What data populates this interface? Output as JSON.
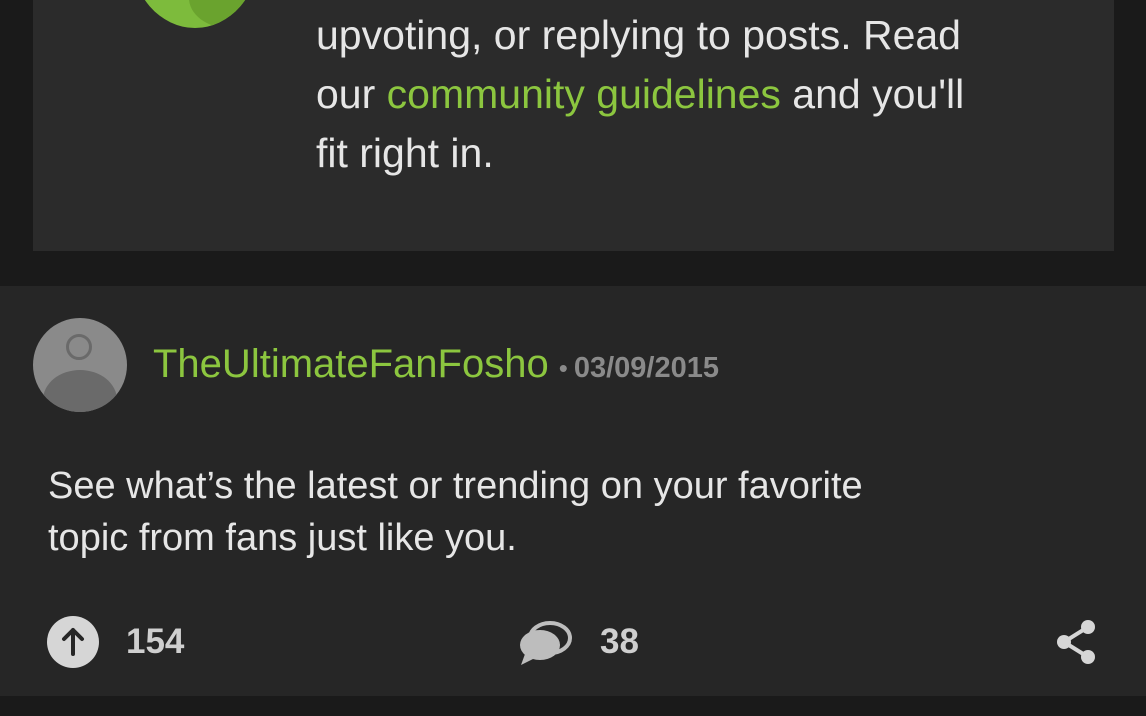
{
  "welcome": {
    "line1": "upvoting, or replying to posts. Read",
    "line2_prefix": "our ",
    "line2_link": "community guidelines",
    "line2_suffix": " and you'll",
    "line3": "fit right in."
  },
  "post": {
    "username": "TheUltimateFanFosho",
    "separator": "•",
    "date": "03/09/2015",
    "body_line1": "See what’s the latest or trending on your favorite",
    "body_line2": "topic from fans just like you.",
    "upvotes": "154",
    "comments": "38"
  },
  "icons": {
    "badge": "green-circle-badge",
    "avatar": "default-user-avatar-icon",
    "upvote": "arrow-up-circle-icon",
    "comment": "speech-bubble-icon",
    "share": "share-icon"
  },
  "colors": {
    "accent": "#8cc63f",
    "background": "#1a1a1a",
    "card": "#262626",
    "text": "#e6e6e6",
    "muted": "#8a8a8a"
  }
}
